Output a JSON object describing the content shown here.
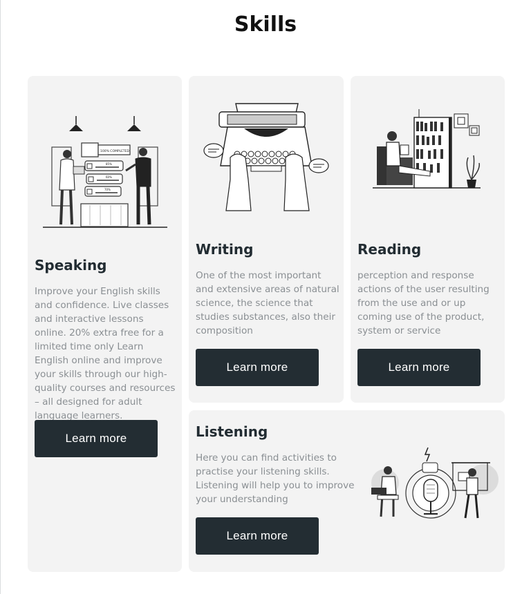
{
  "page": {
    "title": "Skills"
  },
  "cards": {
    "speaking": {
      "title": "Speaking",
      "description": "Improve your English skills and confidence. Live classes and interactive lessons online. 20% extra free for a limited time only Learn English online and improve your skills through our high-quality courses and resources – all designed for adult language learners.",
      "button": "Learn more",
      "illustration_text": {
        "header": "100% COMPLETED",
        "bar1": "85%",
        "bar2": "60%",
        "bar3": "70%"
      }
    },
    "writing": {
      "title": "Writing",
      "description": "One of the most important and extensive areas of natural science, the science that studies substances, also their composition",
      "button": "Learn more"
    },
    "reading": {
      "title": "Reading",
      "description": "perception and response actions of the user resulting from the use and or up coming use of the product, system or service",
      "button": "Learn more"
    },
    "listening": {
      "title": "Listening",
      "description": "Here you can find activities to practise your listening skills. Listening will help you to improve your understanding",
      "button": "Learn more"
    }
  },
  "colors": {
    "card_bg": "#f3f3f3",
    "button_bg": "#232d33",
    "button_text": "#ffffff",
    "body_text": "#8a8f93",
    "heading": "#222c32"
  },
  "icons": [
    "speaking-illustration",
    "typewriter-illustration",
    "reading-illustration",
    "podcast-illustration"
  ]
}
